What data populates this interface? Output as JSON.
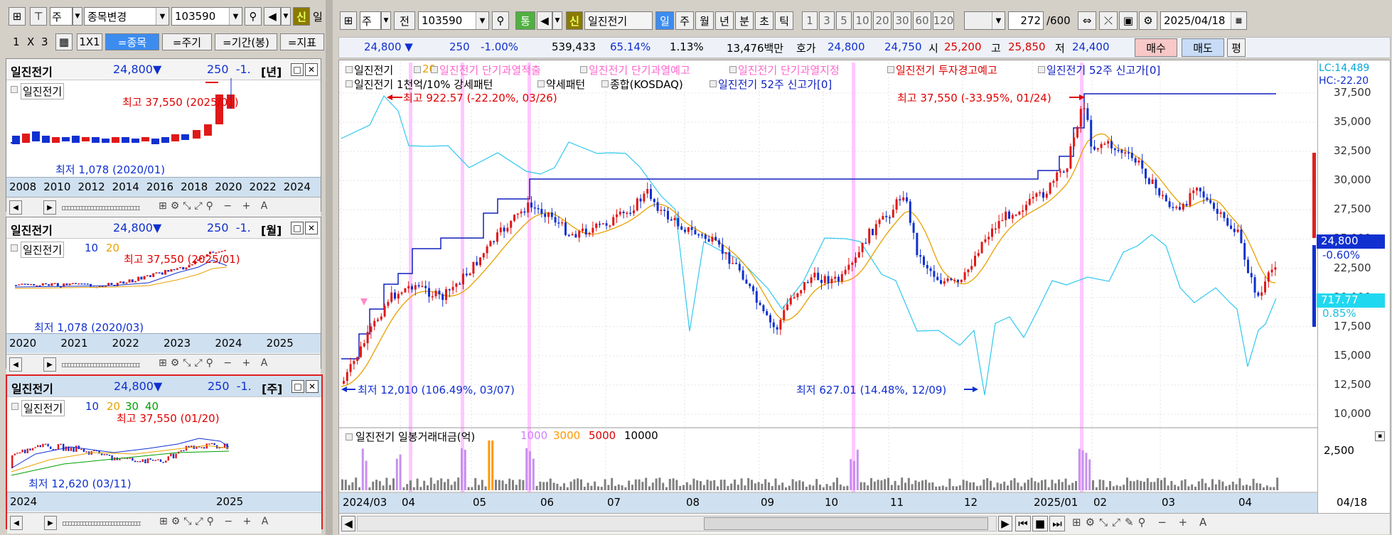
{
  "left_toolbar": {
    "period": "주",
    "search_placeholder": "종목변경",
    "code": "103590",
    "new_badge": "신",
    "new_partial": "일"
  },
  "layout_bar": {
    "l1": "1",
    "x": "X",
    "l3": "3",
    "l1x1": "1X1",
    "tabs": [
      "=종목",
      "=주기",
      "=기간(봉)",
      "=지표"
    ],
    "active_tab": 0
  },
  "panels": [
    {
      "name": "일진전기",
      "price": "24,800",
      "arrow": "▼",
      "chg": "250",
      "pct": "-1.",
      "period": "년",
      "legend": [
        "일진전기"
      ],
      "high": "최고 37,550 (2025/01)",
      "low": "최저 1,078 (2020/01)",
      "xlabels": [
        "2008",
        "2010",
        "2012",
        "2014",
        "2016",
        "2018",
        "2020",
        "2022",
        "2024"
      ]
    },
    {
      "name": "일진전기",
      "price": "24,800",
      "arrow": "▼",
      "chg": "250",
      "pct": "-1.",
      "period": "월",
      "legend": [
        "일진전기",
        "10",
        "20"
      ],
      "high": "최고 37,550 (2025/01)",
      "low": "최저 1,078 (2020/03)",
      "xlabels": [
        "2020",
        "2021",
        "2022",
        "2023",
        "2024",
        "2025"
      ]
    },
    {
      "name": "일진전기",
      "price": "24,800",
      "arrow": "▼",
      "chg": "250",
      "pct": "-1.",
      "period": "주",
      "legend": [
        "일진전기",
        "10",
        "20",
        "30",
        "40"
      ],
      "high": "최고 37,550 (01/20)",
      "low": "최저 12,620 (03/11)",
      "xlabels": [
        "2024",
        "2025"
      ]
    }
  ],
  "main_toolbar": {
    "period": "주",
    "prev": "전",
    "code": "103590",
    "trade": "통",
    "new_badge": "신",
    "stock_name": "일진전기",
    "periods": [
      "일",
      "주",
      "월",
      "년",
      "분",
      "초",
      "틱"
    ],
    "active_period": "일",
    "nums": [
      "1",
      "3",
      "5",
      "10",
      "20",
      "30",
      "60",
      "120"
    ],
    "count": "272",
    "count_total": "/600",
    "date": "2025/04/18"
  },
  "quote_bar": {
    "price": "24,800",
    "arrow": "▼",
    "change": "250",
    "rate": "-1.00%",
    "volume": "539,433",
    "turnover": "65.14%",
    "ratio": "1.13%",
    "amount": "13,476백만",
    "hoga_label": "호가",
    "ask": "24,800",
    "bid": "24,750",
    "open_label": "시",
    "open": "25,200",
    "high_label": "고",
    "high": "25,850",
    "low_label": "저",
    "low": "24,400",
    "buy": "매수",
    "sell": "매도",
    "avg": "평"
  },
  "main_legend": {
    "row1": [
      {
        "t": "일진전기",
        "c": "#000"
      },
      {
        "t": "20",
        "c": "#e8a000"
      },
      {
        "t": "일진전기 단기과열적출",
        "c": "#ff66cc"
      },
      {
        "t": "일진전기 단기과열예고",
        "c": "#ff66cc"
      },
      {
        "t": "일진전기 단기과열지정",
        "c": "#ff66cc"
      },
      {
        "t": "일진전기 투자경고예고",
        "c": "#e00000"
      },
      {
        "t": "일진전기 52주 신고가[0]",
        "c": "#1020c0"
      }
    ],
    "row2": [
      {
        "t": "일진전기 1천억/10% 강세패턴",
        "c": "#000"
      },
      {
        "t": "약세패턴",
        "c": "#000"
      },
      {
        "t": "종합(KOSDAQ)",
        "c": "#000"
      },
      {
        "t": "일진전기 52주 신고가[0]",
        "c": "#1020c0"
      }
    ]
  },
  "annotations": {
    "high_index": "최고 922.57 (-22.20%, 03/26)",
    "high_price": "최고 37,550 (-33.95%, 01/24)",
    "low_price": "최저 12,010 (106.49%, 03/07)",
    "low_index": "최저 627.01 (14.48%, 12/09)"
  },
  "right_axis": {
    "lc": "LC:14,489",
    "hc": "HC:-22.20",
    "ticks": [
      "37,500",
      "35,000",
      "32,500",
      "30,000",
      "27,500",
      "25,000",
      "22,500",
      "20,000",
      "17,500",
      "15,000",
      "12,500",
      "10,000"
    ],
    "price_tag": "24,800",
    "price_pct": "-0.60%",
    "index_tag": "717.77",
    "index_pct": "0.85%",
    "vol_tick": "2,500"
  },
  "volume_legend": [
    {
      "t": "일진전기 일봉거래대금(억)",
      "c": "#000"
    },
    {
      "t": "1000",
      "c": "#d080ff"
    },
    {
      "t": "3000",
      "c": "#ff9900"
    },
    {
      "t": "5000",
      "c": "#e00000"
    },
    {
      "t": "10000",
      "c": "#000"
    }
  ],
  "x_labels": [
    "2024/03",
    "04",
    "05",
    "06",
    "07",
    "08",
    "09",
    "10",
    "11",
    "12",
    "2025/01",
    "02",
    "03",
    "04"
  ],
  "last_date": "04/18",
  "chart_data": {
    "type": "candlestick",
    "title": "일진전기",
    "y_range": [
      10000,
      37500
    ],
    "high": 37550,
    "high_date": "01/24",
    "low": 12010,
    "low_date": "03/07",
    "last": 24800,
    "index_name": "종합(KOSDAQ)",
    "index_high": 922.57,
    "index_low": 627.01,
    "index_last": 717.77
  }
}
